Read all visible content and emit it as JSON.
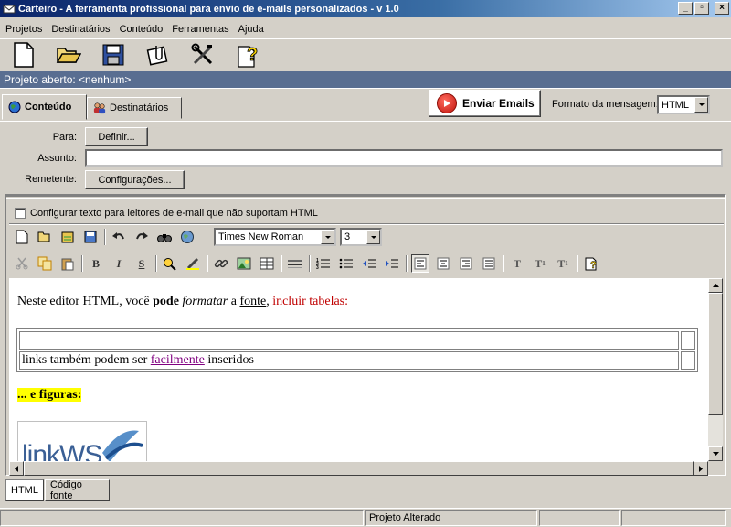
{
  "window": {
    "title": "Carteiro - A ferramenta profissional para envio de e-mails personalizados - v 1.0",
    "controls": [
      "_",
      "▫",
      "×"
    ]
  },
  "menu": [
    "Projetos",
    "Destinatários",
    "Conteúdo",
    "Ferramentas",
    "Ajuda"
  ],
  "toolbar": {
    "icons": [
      "new-file-icon",
      "open-folder-icon",
      "save-disk-icon",
      "attach-clip-icon",
      "tools-icon",
      "help-icon"
    ]
  },
  "project": {
    "status": "Projeto aberto: <nenhum>"
  },
  "tabs": [
    {
      "label": "Conteúdo",
      "active": true
    },
    {
      "label": "Destinatários",
      "active": false
    }
  ],
  "send_button": {
    "label": "Enviar Emails"
  },
  "format": {
    "label": "Formato da mensagem:",
    "value": "HTML"
  },
  "form": {
    "para_label": "Para:",
    "para_button": "Definir...",
    "assunto_label": "Assunto:",
    "assunto_value": "",
    "remetente_label": "Remetente:",
    "remetente_button": "Configurações..."
  },
  "editor": {
    "plain_text_option": "Configurar texto para leitores de e-mail que não suportam HTML",
    "font_name": "Times New Roman",
    "font_size": "3",
    "content": {
      "line1_pre": "Neste editor HTML, você ",
      "line1_bold": "pode",
      "line1_italic": "formatar",
      "line1_mid": " a ",
      "line1_underline": "fonte",
      "line1_comma": ", ",
      "line1_red": "incluir tabelas:",
      "table_row2_pre": "links também podem ser ",
      "table_row2_link": "facilmente",
      "table_row2_post": " inseridos",
      "figures_text": "... e figuras:",
      "logo_text": "linkWS"
    }
  },
  "bottom_tabs": [
    {
      "label": "HTML",
      "active": true
    },
    {
      "label": "Código fonte",
      "active": false
    }
  ],
  "statusbar": {
    "message": "Projeto Alterado"
  }
}
